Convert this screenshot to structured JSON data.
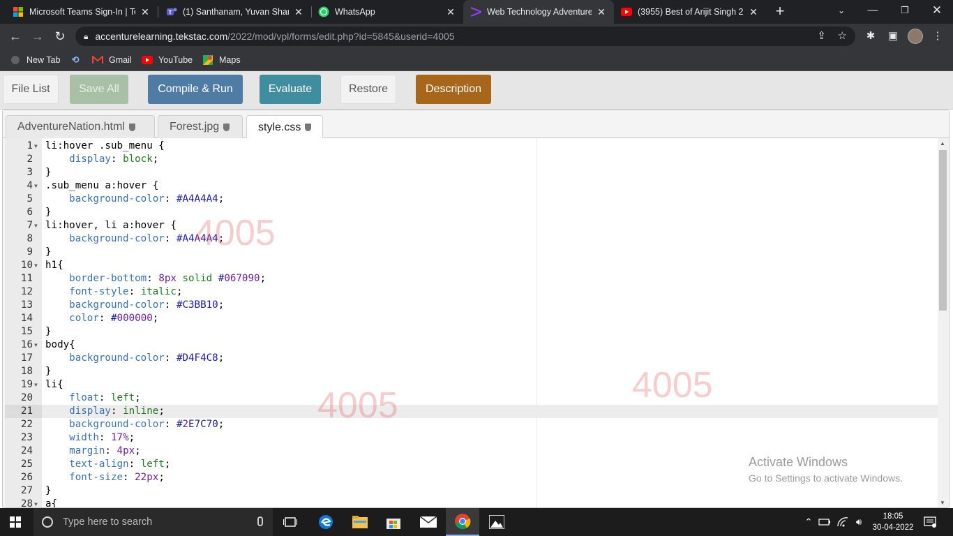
{
  "browser": {
    "tabs": [
      {
        "title": "Microsoft Teams Sign-In | Tea",
        "icon": "microsoft-logo-icon"
      },
      {
        "title": "(1) Santhanam, Yuvan Shanka",
        "icon": "teams-icon"
      },
      {
        "title": "WhatsApp",
        "icon": "whatsapp-icon"
      },
      {
        "title": "Web Technology Adventure N",
        "icon": "vpl-icon",
        "active": true
      },
      {
        "title": "(3955) Best of Arijit Singh 20",
        "icon": "youtube-icon"
      }
    ],
    "url_host": "accenturelearning.tekstac.com",
    "url_path": "/2022/mod/vpl/forms/edit.php?id=5845&userid=4005",
    "bookmarks": [
      {
        "label": "New Tab"
      },
      {
        "label": ""
      },
      {
        "label": "Gmail"
      },
      {
        "label": "YouTube"
      },
      {
        "label": "Maps"
      }
    ]
  },
  "vpl": {
    "buttons": {
      "file_list": "File List",
      "save_all": "Save All",
      "compile_run": "Compile & Run",
      "evaluate": "Evaluate",
      "restore": "Restore",
      "description": "Description"
    },
    "file_tabs": [
      "AdventureNation.html",
      "Forest.jpg",
      "style.css"
    ],
    "active_file": "style.css",
    "watermark": "4005",
    "active_line": 21
  },
  "code_lines": [
    {
      "n": "1",
      "fold": true,
      "text": "li:hover .sub_menu {"
    },
    {
      "n": "2",
      "text": "    display: block;"
    },
    {
      "n": "3",
      "text": "}"
    },
    {
      "n": "4",
      "fold": true,
      "text": ".sub_menu a:hover {"
    },
    {
      "n": "5",
      "text": "    background-color: #A4A4A4;"
    },
    {
      "n": "6",
      "text": "}"
    },
    {
      "n": "7",
      "fold": true,
      "text": "li:hover, li a:hover {"
    },
    {
      "n": "8",
      "text": "    background-color: #A4A4A4;"
    },
    {
      "n": "9",
      "text": "}"
    },
    {
      "n": "10",
      "fold": true,
      "text": "h1{"
    },
    {
      "n": "11",
      "text": "    border-bottom: 8px solid #067090;"
    },
    {
      "n": "12",
      "text": "    font-style: italic;"
    },
    {
      "n": "13",
      "text": "    background-color: #C3BB10;"
    },
    {
      "n": "14",
      "text": "    color: #000000;"
    },
    {
      "n": "15",
      "text": "}"
    },
    {
      "n": "16",
      "fold": true,
      "text": "body{"
    },
    {
      "n": "17",
      "text": "    background-color: #D4F4C8;"
    },
    {
      "n": "18",
      "text": "}"
    },
    {
      "n": "19",
      "fold": true,
      "text": "li{"
    },
    {
      "n": "20",
      "text": "    float: left;"
    },
    {
      "n": "21",
      "text": "    display: inline;"
    },
    {
      "n": "22",
      "text": "    background-color: #2E7C70;"
    },
    {
      "n": "23",
      "text": "    width: 17%;"
    },
    {
      "n": "24",
      "text": "    margin: 4px;"
    },
    {
      "n": "25",
      "text": "    text-align: left;"
    },
    {
      "n": "26",
      "text": "    font-size: 22px;"
    },
    {
      "n": "27",
      "text": "}"
    },
    {
      "n": "28",
      "fold": true,
      "text": "a{"
    }
  ],
  "windows": {
    "activate_title": "Activate Windows",
    "activate_sub": "Go to Settings to activate Windows.",
    "search_placeholder": "Type here to search",
    "time": "18:05",
    "date": "30-04-2022"
  }
}
